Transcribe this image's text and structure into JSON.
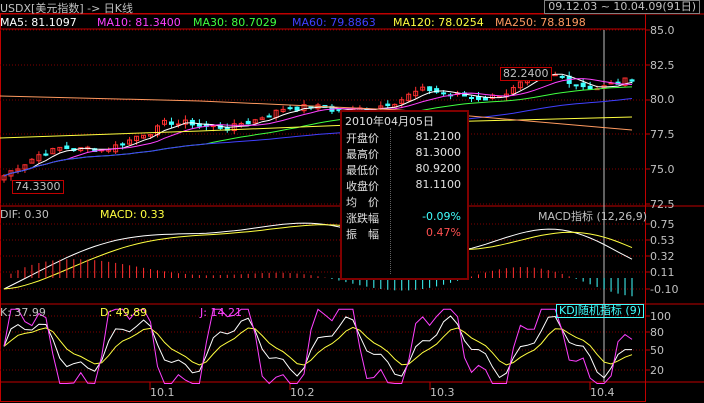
{
  "header": {
    "title": "USDX[美元指数] -> 日K线",
    "date_range": "09.12.03 ~ 10.04.09(91日)"
  },
  "moving_averages": [
    {
      "label": "MA5: 81.1097",
      "color": "#ffffff"
    },
    {
      "label": "MA10: 81.3400",
      "color": "#ff40ff"
    },
    {
      "label": "MA30: 80.7029",
      "color": "#40ff40"
    },
    {
      "label": "MA60: 79.8863",
      "color": "#4040ff"
    },
    {
      "label": "MA120: 78.0254",
      "color": "#ffff40"
    },
    {
      "label": "MA250: 78.8198",
      "color": "#ff9a60"
    }
  ],
  "price_axis": [
    "85.0",
    "82.5",
    "80.0",
    "77.5",
    "75.0",
    "72.5"
  ],
  "price_labels": {
    "high": "82.2400",
    "low": "74.3300"
  },
  "macd": {
    "dif": "DIF: 0.30",
    "macd": "MACD: 0.33",
    "title": "MACD指标 (12,26,9)",
    "axis": [
      "0.75",
      "0.53",
      "0.32",
      "0.11",
      "-0.10"
    ]
  },
  "kdj": {
    "k": "K: 37.99",
    "d": "D: 49.89",
    "j": "J: 14.21",
    "title": "KDJ随机指标 (9)",
    "axis": [
      "100",
      "80",
      "50",
      "20"
    ]
  },
  "x_axis": [
    "10.1",
    "10.2",
    "10.3",
    "10.4"
  ],
  "tooltip": {
    "date": "2010年04月05日",
    "rows": [
      {
        "label": "开盘价",
        "value": "81.2100",
        "color": "#e0e0e0"
      },
      {
        "label": "最高价",
        "value": "81.3000",
        "color": "#e0e0e0"
      },
      {
        "label": "最低价",
        "value": "80.9200",
        "color": "#e0e0e0"
      },
      {
        "label": "收盘价",
        "value": "81.1100",
        "color": "#e0e0e0"
      },
      {
        "label": "均　价",
        "value": "",
        "color": "#e0e0e0"
      },
      {
        "label": "涨跌幅",
        "value": "-0.09%",
        "color": "#40ffff"
      },
      {
        "label": "振　幅",
        "value": "0.47%",
        "color": "#ff5050"
      }
    ]
  },
  "colors": {
    "up": "#ff3030",
    "down": "#40ffff",
    "border": "#c00000",
    "grid": "#800000"
  }
}
